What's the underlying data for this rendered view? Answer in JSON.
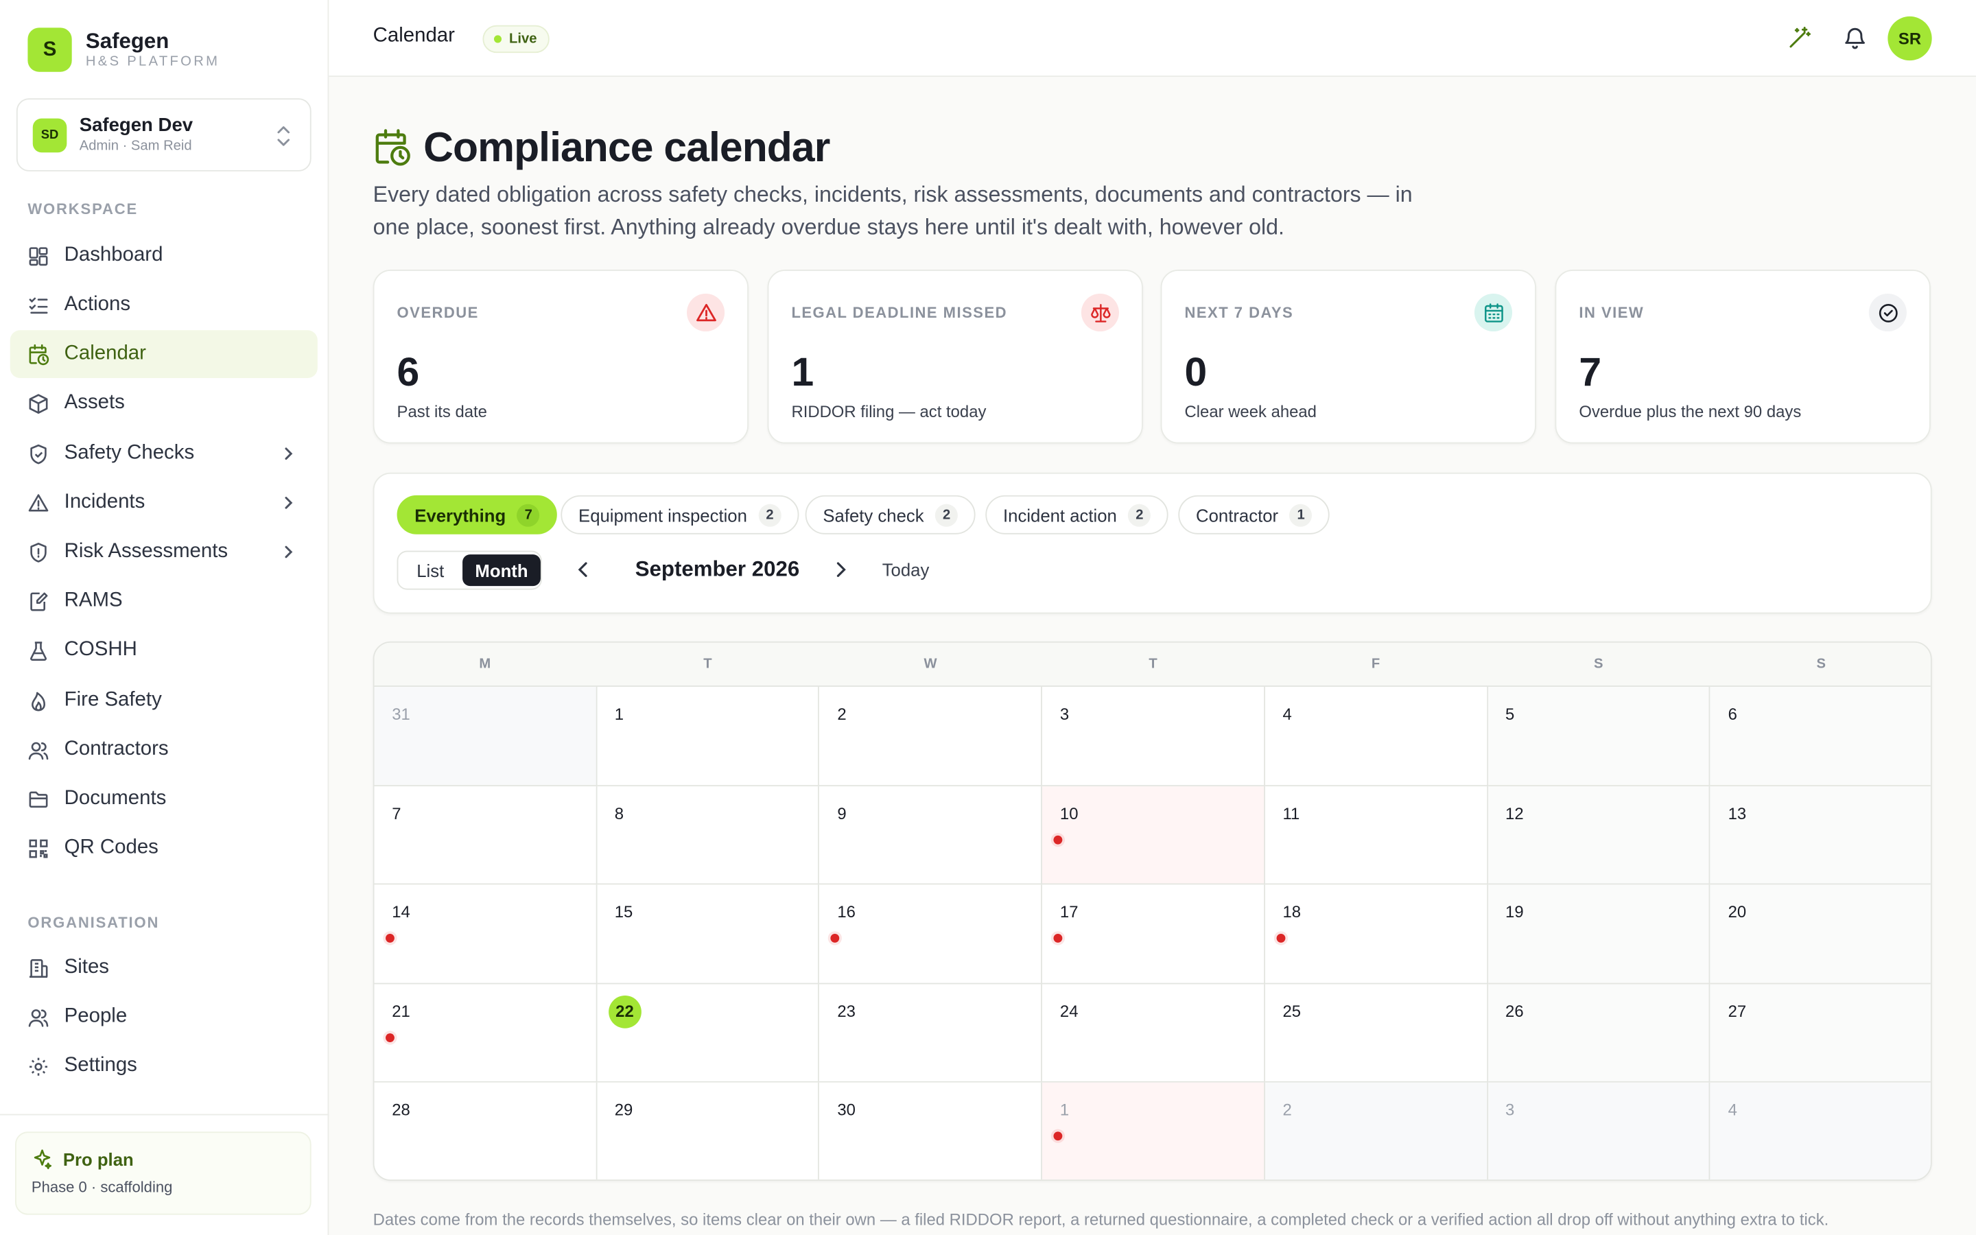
{
  "brand": {
    "logo_letter": "S",
    "name": "Safegen",
    "subtitle": "H&S PLATFORM",
    "accent": "#a3e635"
  },
  "workspace": {
    "avatar": "SD",
    "name": "Safegen Dev",
    "sub": "Admin · Sam Reid"
  },
  "sidebar": {
    "workspace_heading": "WORKSPACE",
    "items": [
      {
        "label": "Dashboard",
        "icon": "dashboard-icon"
      },
      {
        "label": "Actions",
        "icon": "checklist-icon"
      },
      {
        "label": "Calendar",
        "icon": "calendar-clock-icon",
        "active": true
      },
      {
        "label": "Assets",
        "icon": "box-icon"
      },
      {
        "label": "Safety Checks",
        "icon": "shield-check-icon",
        "expandable": true
      },
      {
        "label": "Incidents",
        "icon": "warning-icon",
        "expandable": true
      },
      {
        "label": "Risk Assessments",
        "icon": "shield-alert-icon",
        "expandable": true
      },
      {
        "label": "RAMS",
        "icon": "file-edit-icon"
      },
      {
        "label": "COSHH",
        "icon": "flask-icon"
      },
      {
        "label": "Fire Safety",
        "icon": "flame-icon"
      },
      {
        "label": "Contractors",
        "icon": "users-icon"
      },
      {
        "label": "Documents",
        "icon": "folder-icon"
      },
      {
        "label": "QR Codes",
        "icon": "qr-code-icon"
      }
    ],
    "org_heading": "ORGANISATION",
    "org_items": [
      {
        "label": "Sites",
        "icon": "building-icon"
      },
      {
        "label": "People",
        "icon": "people-icon"
      },
      {
        "label": "Settings",
        "icon": "gear-icon"
      }
    ],
    "plan": {
      "title": "Pro plan",
      "sub": "Phase 0 · scaffolding"
    }
  },
  "topbar": {
    "title": "Calendar",
    "badge": "Live",
    "user_initials": "SR"
  },
  "main": {
    "title": "Compliance calendar",
    "description": "Every dated obligation across safety checks, incidents, risk assessments, documents and contractors — in one place, soonest first. Anything already overdue stays here until it's dealt with, however old.",
    "stats": [
      {
        "label": "OVERDUE",
        "value": "6",
        "sub": "Past its date",
        "icon": "warning-icon",
        "color": "#dc2626"
      },
      {
        "label": "LEGAL DEADLINE MISSED",
        "value": "1",
        "sub": "RIDDOR filing — act today",
        "icon": "scales-icon",
        "color": "#dc2626"
      },
      {
        "label": "NEXT 7 DAYS",
        "value": "0",
        "sub": "Clear week ahead",
        "icon": "calendar-icon",
        "color": "#0d9488"
      },
      {
        "label": "IN VIEW",
        "value": "7",
        "sub": "Overdue plus the next 90 days",
        "icon": "check-circle-icon",
        "color": "#1a1d26"
      }
    ],
    "filters": [
      {
        "label": "Everything",
        "count": "7",
        "active": true
      },
      {
        "label": "Equipment inspection",
        "count": "2"
      },
      {
        "label": "Safety check",
        "count": "2"
      },
      {
        "label": "Incident action",
        "count": "2"
      },
      {
        "label": "Contractor",
        "count": "1"
      }
    ],
    "view_toggle": {
      "list": "List",
      "month": "Month",
      "selected": "Month"
    },
    "month_label": "September 2026",
    "today_label": "Today",
    "weekdays": [
      "M",
      "T",
      "W",
      "T",
      "F",
      "S",
      "S"
    ],
    "weeks": [
      [
        {
          "d": "31",
          "outside": true
        },
        {
          "d": "1"
        },
        {
          "d": "2"
        },
        {
          "d": "3"
        },
        {
          "d": "4"
        },
        {
          "d": "5"
        },
        {
          "d": "6"
        }
      ],
      [
        {
          "d": "7"
        },
        {
          "d": "8"
        },
        {
          "d": "9"
        },
        {
          "d": "10",
          "flagged": true,
          "dot": true
        },
        {
          "d": "11"
        },
        {
          "d": "12"
        },
        {
          "d": "13"
        }
      ],
      [
        {
          "d": "14",
          "dot": true
        },
        {
          "d": "15"
        },
        {
          "d": "16",
          "dot": true
        },
        {
          "d": "17",
          "dot": true
        },
        {
          "d": "18",
          "dot": true
        },
        {
          "d": "19"
        },
        {
          "d": "20"
        }
      ],
      [
        {
          "d": "21",
          "dot": true
        },
        {
          "d": "22",
          "today": true
        },
        {
          "d": "23"
        },
        {
          "d": "24"
        },
        {
          "d": "25"
        },
        {
          "d": "26"
        },
        {
          "d": "27"
        }
      ],
      [
        {
          "d": "28"
        },
        {
          "d": "29"
        },
        {
          "d": "30"
        },
        {
          "d": "1",
          "outside": true,
          "flagged": true,
          "dot": true
        },
        {
          "d": "2",
          "outside": true
        },
        {
          "d": "3",
          "outside": true
        },
        {
          "d": "4",
          "outside": true
        }
      ]
    ],
    "footnote": "Dates come from the records themselves, so items clear on their own — a filed RIDDOR report, a returned questionnaire, a completed check or a verified action all drop off without anything extra to tick."
  }
}
